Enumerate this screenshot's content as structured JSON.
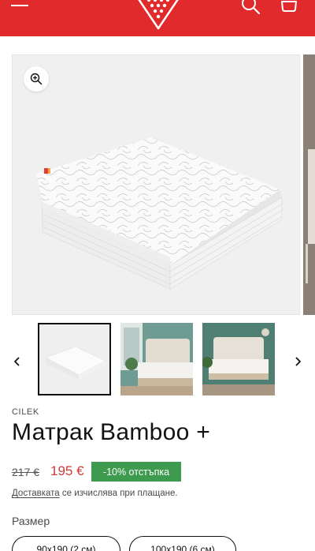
{
  "header": {
    "menu_icon": "hamburger-icon",
    "logo": "brand-logo",
    "search_icon": "search-icon",
    "cart_icon": "cart-icon",
    "brand_color": "#e02a2b"
  },
  "gallery": {
    "zoom_icon": "zoom-in-icon",
    "prev_icon": "chevron-left-icon",
    "next_icon": "chevron-right-icon",
    "thumbnails": [
      {
        "name": "mattress-studio",
        "active": true
      },
      {
        "name": "bedroom-window",
        "active": false
      },
      {
        "name": "bedroom-green-wall",
        "active": false
      }
    ]
  },
  "product": {
    "vendor": "CILEK",
    "title": "Матрак Bamboo +",
    "price_old": "217 €",
    "price_new": "195 €",
    "discount_badge": "-10% отстъпка",
    "shipping_link": "Доставката",
    "shipping_rest": " се изчислява при плащане.",
    "size_label": "Размер",
    "size_options": [
      "90х190 (2 см)",
      "100х190 (6 см)"
    ]
  }
}
